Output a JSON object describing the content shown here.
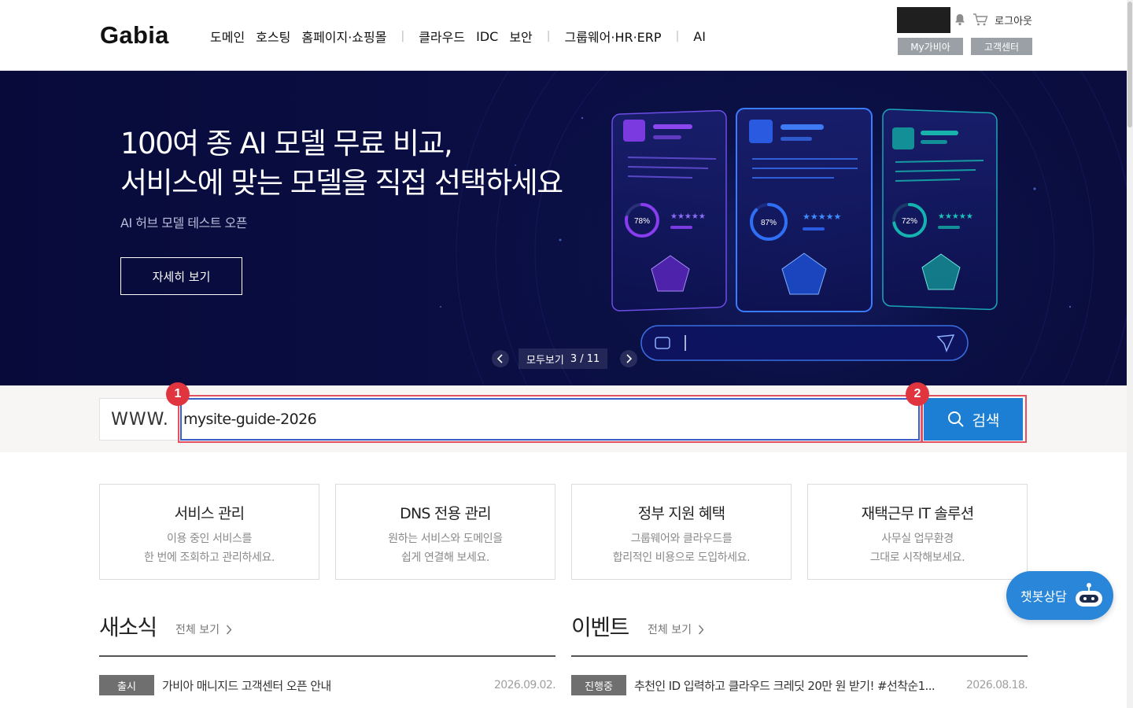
{
  "header": {
    "logo": "Gabia",
    "nav": [
      "도메인",
      "호스팅",
      "홈페이지·쇼핑몰",
      "클라우드",
      "IDC",
      "보안",
      "그룹웨어·HR·ERP",
      "AI"
    ],
    "logout": "로그아웃",
    "my_gabia": "My가비아",
    "customer_center": "고객센터"
  },
  "hero": {
    "title_line1": "100여 종 AI 모델 무료 비교,",
    "title_line2": "서비스에 맞는 모델을 직접 선택하세요",
    "subtitle": "AI 허브 모델 테스트 오픈",
    "button": "자세히 보기",
    "pager_label": "모두보기",
    "pager_count": "3 / 11",
    "cards": [
      {
        "percent": "78%",
        "value": 0.78,
        "color": "#8a3cf0"
      },
      {
        "percent": "87%",
        "value": 0.87,
        "color": "#2f6ff5"
      },
      {
        "percent": "72%",
        "value": 0.72,
        "color": "#14b3b0"
      }
    ]
  },
  "search": {
    "prefix": "WWW.",
    "value": "mysite-guide-2026",
    "button": "검색",
    "marker1": "1",
    "marker2": "2"
  },
  "services": [
    {
      "title": "서비스 관리",
      "line1": "이용 중인 서비스를",
      "line2": "한 번에 조회하고 관리하세요."
    },
    {
      "title": "DNS 전용 관리",
      "line1": "원하는 서비스와 도메인을",
      "line2": "쉽게 연결해 보세요."
    },
    {
      "title": "정부 지원 혜택",
      "line1": "그룹웨어와 클라우드를",
      "line2": "합리적인 비용으로 도입하세요."
    },
    {
      "title": "재택근무 IT 솔루션",
      "line1": "사무실 업무환경",
      "line2": "그대로 시작해보세요."
    }
  ],
  "news": {
    "title": "새소식",
    "more": "전체 보기",
    "items": [
      {
        "badge": "출시",
        "title": "가비아 매니지드 고객센터 오픈 안내",
        "date": "2026.09.02."
      }
    ]
  },
  "events": {
    "title": "이벤트",
    "more": "전체 보기",
    "items": [
      {
        "badge": "진행중",
        "title": "추천인 ID 입력하고 클라우드 크레딧 20만 원 받기! #선착순1...",
        "date": "2026.08.18."
      }
    ]
  },
  "chatbot": {
    "label": "챗봇상담"
  },
  "colors": {
    "hero_bg": "#0a0e44",
    "search_button": "#1d7fd3",
    "highlight": "#e25260",
    "marker": "#e0353f",
    "chatbot": "#2a86d8"
  }
}
